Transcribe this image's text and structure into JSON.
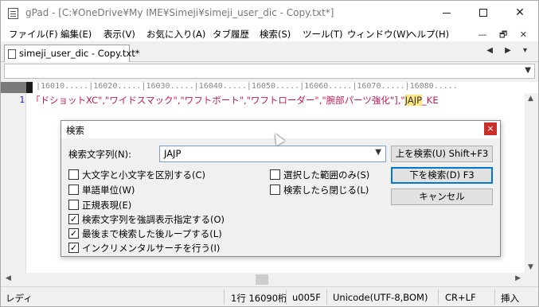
{
  "window": {
    "title": "gPad - [C:¥OneDrive¥My IME¥Simeji¥simeji_user_dic - Copy.txt*]",
    "minimize": "—",
    "maximize": "☐",
    "close": "✕"
  },
  "menu": {
    "items": [
      "ファイル(F)",
      "編集(E)",
      "表示(V)",
      "お気に入り(A)",
      "タブ履歴",
      "検索(S)",
      "ツール(T)",
      "ウィンドウ(W)",
      "ヘルプ(H)"
    ],
    "mdi": "— 🗗 ✕"
  },
  "tabs": [
    {
      "label": "simeji_user_dic - Copy.txt*",
      "active": true
    }
  ],
  "tab_nav": "◀ ▶ ▾",
  "editor": {
    "ruler": "|16010.....|16020.....|16030.....|16040.....|16050.....|16060.....|16070.....|16080.....",
    "line_number": "1",
    "line_text_before": "「ドショットXC\",\"ワイドスマック\",\"ワフトボート\",\"ワフトローダー\",\"腕部パーツ強化\"],\"",
    "line_text_highlight": "JAJP",
    "line_text_after": "_KE"
  },
  "dialog": {
    "title": "検索",
    "close": "×",
    "search_label": "検索文字列(N):",
    "search_value": "JAJP",
    "buttons": {
      "search_up": "上を検索(U) Shift+F3",
      "search_down": "下を検索(D) F3",
      "cancel": "キャンセル"
    },
    "options_left": [
      {
        "label": "大文字と小文字を区別する(C)",
        "checked": false
      },
      {
        "label": "単語単位(W)",
        "checked": false
      },
      {
        "label": "正規表現(E)",
        "checked": false
      },
      {
        "label": "検索文字列を強調表示指定する(O)",
        "checked": true
      },
      {
        "label": "最後まで検索した後ループする(L)",
        "checked": true
      },
      {
        "label": "インクリメンタルサーチを行う(I)",
        "checked": true
      }
    ],
    "options_right": [
      {
        "label": "選択した範囲のみ(S)",
        "checked": false
      },
      {
        "label": "検索したら閉じる(L)",
        "checked": false
      }
    ]
  },
  "status": {
    "ready": "レディ",
    "position": "1行 16090桁",
    "char_code": "u005F",
    "encoding": "Unicode(UTF-8,BOM)",
    "line_ending": "CR+LF",
    "insert_mode": "挿入"
  }
}
